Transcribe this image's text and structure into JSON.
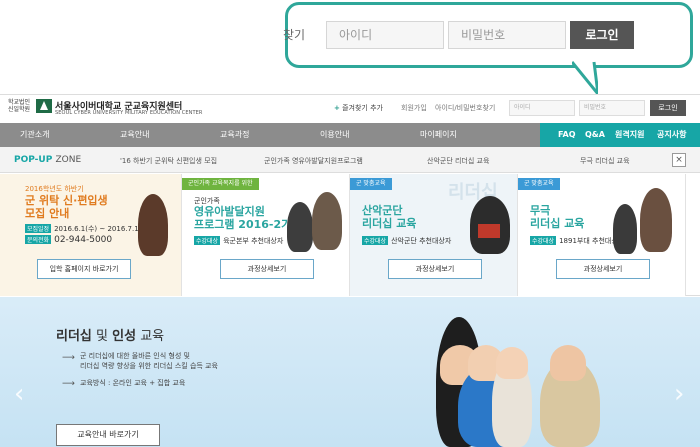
{
  "callout": {
    "find_text": "찾기",
    "id_placeholder": "아이디",
    "pw_placeholder": "비밀번호",
    "login_label": "로그인"
  },
  "header": {
    "logo_small": "학교법인 신일학원",
    "logo_title": "서울사이버대학교 군교육지원센터",
    "logo_sub": "SEOUL CYBER UNIVERSITY  MILITARY EDUCATION CENTER",
    "favorite": "즐겨찾기 추가",
    "signup": "회원가입",
    "find": "아이디/비밀번호찾기",
    "id_placeholder": "아이디",
    "pw_placeholder": "비밀번호",
    "login": "로그인"
  },
  "nav": {
    "items": [
      "기관소개",
      "교육안내",
      "교육과정",
      "이용안내",
      "마이페이지"
    ],
    "right": [
      "FAQ",
      "Q&A",
      "원격지원",
      "공지사항"
    ]
  },
  "popup_zone": {
    "title_a": "POP-UP",
    "title_b": "ZONE",
    "items": [
      "'16 하반기 군위탁 신편입생 모집",
      "군인가족 영유아발달지원프로그램",
      "산악군단 리더십 교육",
      "무극 리더십 교육"
    ],
    "close": "×"
  },
  "cards": [
    {
      "t1": "2016학년도 하반기",
      "t2a": "군 위탁 신·편입생",
      "t2b": "모집 안내",
      "row1_label": "모집일정",
      "row1_value": "2016.6.1(수) ~ 2016.7.12(화)",
      "row2_label": "문의전화",
      "row2_value": "02-944-5000",
      "button": "입학 홈페이지 바로가기"
    },
    {
      "tag": "군인가족 교육복지를 위한",
      "t1": "군인가족",
      "t2a": "영유아발달지원",
      "t2b": "프로그램 2016-2기",
      "row1_label": "수강대상",
      "row1_value": "육군본부 추천대상자",
      "button": "과정상세보기"
    },
    {
      "tag": "군 맞춤교육",
      "watermark": "리더십",
      "t2a": "산악군단",
      "t2b": "리더십 교육",
      "row1_label": "수강대상",
      "row1_value": "산악군단 추천대상자",
      "button": "과정상세보기"
    },
    {
      "tag": "군 맞춤교육",
      "t2a": "무극",
      "t2b": "리더십 교육",
      "row1_label": "수강대상",
      "row1_value": "1891부대 추천대상자",
      "button": "과정상세보기"
    }
  ],
  "banner": {
    "title_a": "리더십",
    "title_mid": "및",
    "title_b": "인성",
    "title_c": "교육",
    "line1": "군 리더십에 대한 올바른 인식 형성 및",
    "line2": "리더십 역량 향상을 위한 리더십 스킬 습득 교육",
    "line3": "교육방식 : 온라인 교육 + 집합 교육",
    "button": "교육안내 바로가기",
    "arrow_left": "‹",
    "arrow_right": "›"
  },
  "colors": {
    "accent": "#17a6a6",
    "nav": "#8c8c8c",
    "callout": "#2fa79a"
  }
}
